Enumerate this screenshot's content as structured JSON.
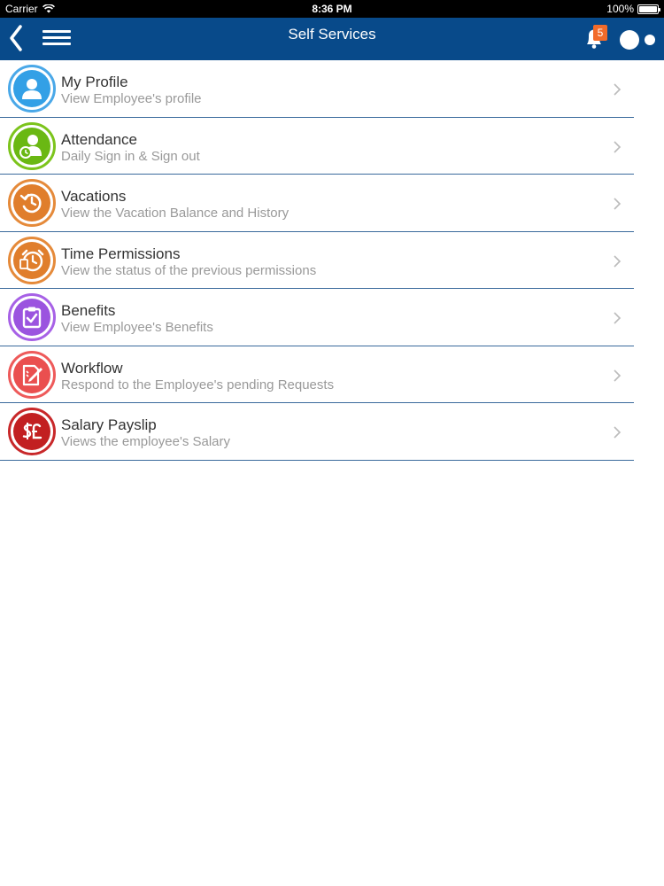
{
  "status_bar": {
    "carrier": "Carrier",
    "time": "8:36 PM",
    "battery": "100%"
  },
  "nav": {
    "title": "Self Services",
    "notification_count": "5",
    "back_icon": "chevron-left-icon",
    "menu_icon": "hamburger-menu-icon",
    "bell_icon": "bell-icon",
    "toggle_icon": "toggle-icon"
  },
  "colors": {
    "nav_background": "#084a8a",
    "badge": "#f26b2a",
    "row_divider": "#3a6a9c"
  },
  "items": [
    {
      "title": "My Profile",
      "subtitle": "View Employee's profile",
      "icon": "person-icon",
      "ring": "#4aa8e8",
      "fill": "#33a0e6"
    },
    {
      "title": "Attendance",
      "subtitle": "Daily Sign in & Sign out",
      "icon": "person-clock-icon",
      "ring": "#7cc41c",
      "fill": "#6ab813"
    },
    {
      "title": "Vacations",
      "subtitle": "View the Vacation Balance and History",
      "icon": "history-icon",
      "ring": "#e58a3a",
      "fill": "#e07e2c"
    },
    {
      "title": "Time Permissions",
      "subtitle": "View the status of the previous permissions",
      "icon": "alarm-clock-icon",
      "ring": "#e58a3a",
      "fill": "#e07e2c"
    },
    {
      "title": "Benefits",
      "subtitle": "View Employee's Benefits",
      "icon": "clipboard-check-icon",
      "ring": "#a761e6",
      "fill": "#9b54df"
    },
    {
      "title": "Workflow",
      "subtitle": "Respond to the Employee's pending Requests",
      "icon": "document-edit-icon",
      "ring": "#ee5a5a",
      "fill": "#ea4f4f"
    },
    {
      "title": "Salary Payslip",
      "subtitle": "Views the employee's Salary",
      "icon": "currency-icon",
      "ring": "#c8282a",
      "fill": "#c21f21"
    }
  ]
}
